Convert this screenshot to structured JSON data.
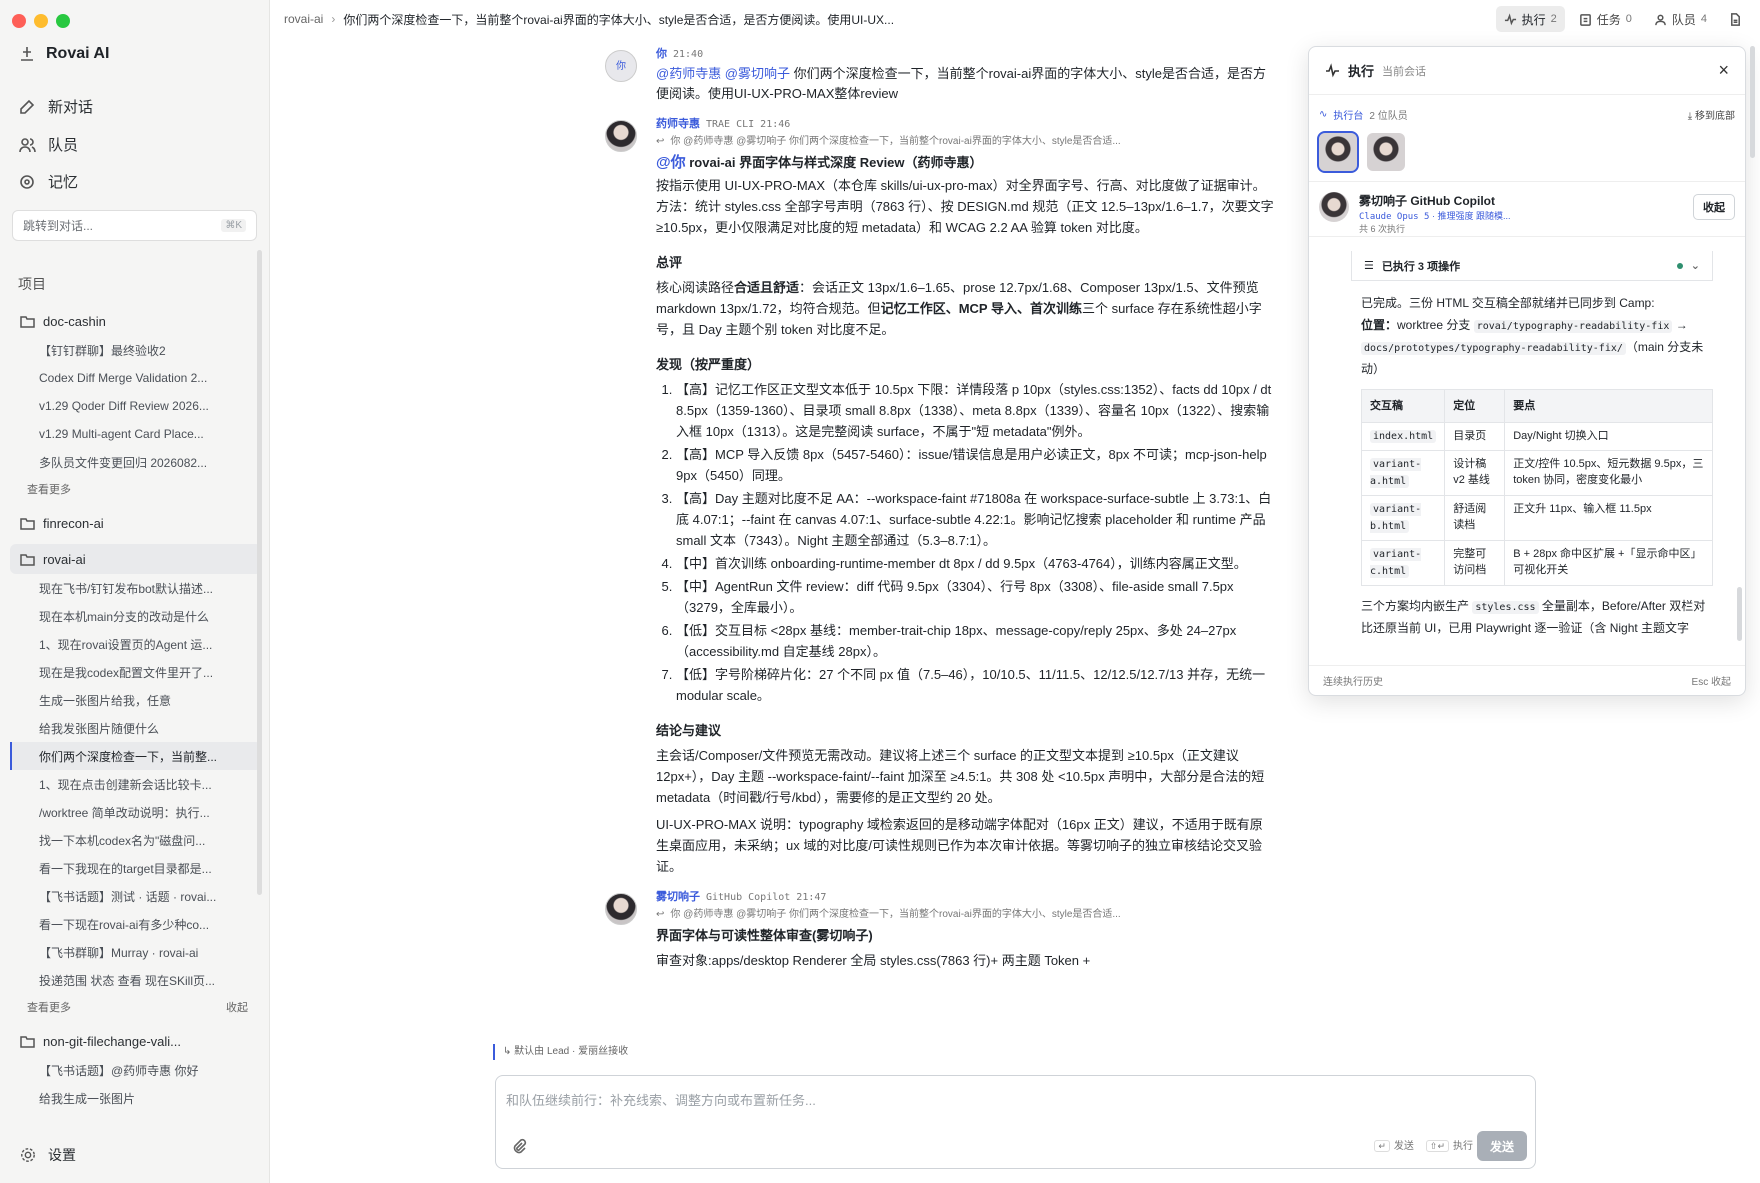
{
  "app": {
    "name": "Rovai AI",
    "traffic": [
      "#fe5f57",
      "#febc2e",
      "#28c840"
    ]
  },
  "nav": {
    "new_chat": "新对话",
    "team": "队员",
    "memory": "记忆"
  },
  "jump": {
    "placeholder": "跳转到对话...",
    "shortcut": "⌘K"
  },
  "projects_label": "项目",
  "projects": [
    {
      "name": "doc-cashin",
      "items": [
        "【钉钉群聊】最终验收2",
        "Codex Diff Merge Validation 2...",
        "v1.29 Qoder Diff Review 2026...",
        "v1.29 Multi-agent Card Place...",
        "多队员文件变更回归 2026082..."
      ],
      "more": "查看更多",
      "collapse": ""
    },
    {
      "name": "finrecon-ai",
      "items": [],
      "more": "",
      "collapse": ""
    },
    {
      "name": "rovai-ai",
      "items": [
        "现在飞书/钉钉发布bot默认描述...",
        "现在本机main分支的改动是什么",
        "1、现在rovai设置页的Agent 运...",
        "现在是我codex配置文件里开了...",
        "生成一张图片给我，任意",
        "给我发张图片随便什么",
        "你们两个深度检查一下，当前整...",
        "1、现在点击创建新会话比较卡...",
        "/worktree 简单改动说明：执行...",
        "找一下本机codex名为\"磁盘问...",
        "看一下我现在的target目录都是...",
        "【飞书话题】测试 · 话题 · rovai...",
        "看一下现在rovai-ai有多少种co...",
        "【飞书群聊】Murray · rovai-ai",
        "投递范围 状态 查看 现在SKill页..."
      ],
      "more": "查看更多",
      "collapse": "收起"
    },
    {
      "name": "non-git-filechange-vali...",
      "items": [
        "【飞书话题】@药师寺惠 你好",
        "给我生成一张图片"
      ],
      "more": "",
      "collapse": ""
    }
  ],
  "settings": "设置",
  "topbar": {
    "crumb": "rovai-ai",
    "sep": "›",
    "title": "你们两个深度检查一下，当前整个rovai-ai界面的字体大小、style是否合适，是否方便阅读。使用UI-UX...",
    "exec": {
      "label": "执行",
      "count": "2"
    },
    "tasks": {
      "label": "任务",
      "count": "0"
    },
    "members": {
      "label": "队员",
      "count": "4"
    }
  },
  "messages": {
    "user": {
      "avatar": "你",
      "name": "你",
      "time": "21:40",
      "mentions": "@药师寺惠 @雾切响子",
      "text": " 你们两个深度检查一下，当前整个rovai-ai界面的字体大小、style是否合适，是否方便阅读。使用UI-UX-PRO-MAX整体review"
    },
    "yaoshi": {
      "name": "药师寺惠",
      "source": "TRAE CLI",
      "time": "21:46",
      "reply": "你 @药师寺惠 @雾切响子 你们两个深度检查一下，当前整个rovai-ai界面的字体大小、style是否合适...",
      "at": "@你",
      "title": " rovai-ai 界面字体与样式深度 Review（药师寺惠）",
      "intro": "按指示使用 UI-UX-PRO-MAX（本仓库 skills/ui-ux-pro-max）对全界面字号、行高、对比度做了证据审计。方法：统计 styles.css 全部字号声明（7863 行）、按 DESIGN.md 规范（正文 12.5–13px/1.6–1.7，次要文字 ≥10.5px，更小仅限满足对比度的短 metadata）和 WCAG 2.2 AA 验算 token 对比度。",
      "h_summary": "总评",
      "summary_a": "核心阅读路径",
      "summary_b": "合适且舒适",
      "summary_c": "：会话正文 13px/1.6–1.65、prose 12.7px/1.68、Composer 13px/1.5、文件预览 markdown 13px/1.72，均符合规范。但",
      "summary_d": "记忆工作区、MCP 导入、首次训练",
      "summary_e": "三个 surface 存在系统性超小字号，且 Day 主题个别 token 对比度不足。",
      "h_findings": "发现（按严重度）",
      "findings": [
        "【高】记忆工作区正文型文本低于 10.5px 下限：详情段落 p 10px（styles.css:1352）、facts dd 10px / dt 8.5px（1359-1360）、目录项 small 8.8px（1338）、meta 8.8px（1339）、容量名 10px（1322）、搜索输入框 10px（1313）。这是完整阅读 surface，不属于\"短 metadata\"例外。",
        "【高】MCP 导入反馈 8px（5457-5460）：issue/错误信息是用户必读正文，8px 不可读；mcp-json-help 9px（5450）同理。",
        "【高】Day 主题对比度不足 AA：--workspace-faint #71808a 在 workspace-surface-subtle 上 3.73:1、白底 4.07:1；--faint 在 canvas 4.07:1、surface-subtle 4.22:1。影响记忆搜索 placeholder 和 runtime 产品 small 文本（7343）。Night 主题全部通过（5.3–8.7:1）。",
        "【中】首次训练 onboarding-runtime-member dt 8px / dd 9.5px（4763-4764），训练内容属正文型。",
        "【中】AgentRun 文件 review：diff 代码 9.5px（3304）、行号 8px（3308）、file-aside small 7.5px（3279，全库最小）。",
        "【低】交互目标 <28px 基线：member-trait-chip 18px、message-copy/reply 25px、多处 24–27px（accessibility.md 自定基线 28px）。",
        "【低】字号阶梯碎片化：27 个不同 px 值（7.5–46），10/10.5、11/11.5、12/12.5/12.7/13 并存，无统一 modular scale。"
      ],
      "h_conclusion": "结论与建议",
      "conclusion": "主会话/Composer/文件预览无需改动。建议将上述三个 surface 的正文型文本提到 ≥10.5px（正文建议 12px+），Day 主题 --workspace-faint/--faint 加深至 ≥4.5:1。共 308 处 <10.5px 声明中，大部分是合法的短 metadata（时间戳/行号/kbd），需要修的是正文型约 20 处。",
      "note": "UI-UX-PRO-MAX 说明：typography 域检索返回的是移动端字体配对（16px 正文）建议，不适用于既有原生桌面应用，未采纳；ux 域的对比度/可读性规则已作为本次审计依据。等雾切响子的独立审核结论交叉验证。"
    },
    "wuqie": {
      "name": "雾切响子",
      "source": "GitHub Copilot",
      "time": "21:47",
      "reply": "你 @药师寺惠 @雾切响子 你们两个深度检查一下，当前整个rovai-ai界面的字体大小、style是否合适...",
      "title": "界面字体与可读性整体审查(雾切响子)",
      "text": "审查对象:apps/desktop Renderer 全局 styles.css(7863 行)+ 两主题 Token +"
    }
  },
  "handoff": "默认由 Lead · 爱丽丝接收",
  "composer": {
    "placeholder": "和队伍继续前行：补充线索、调整方向或布置新任务...",
    "send_hint": "发送",
    "exec_hint": "执行",
    "send_key": "↵",
    "exec_key": "⇧↵",
    "send": "发送"
  },
  "panel": {
    "title": "执行",
    "subtitle": "当前会话",
    "close": "×",
    "bench": "执行台",
    "member_count": "2 位队员",
    "to_bottom": "移到底部",
    "agent": {
      "name": "雾切响子 GitHub Copilot",
      "model": "Claude Opus 5",
      "effort": "推理强度",
      "mode": "跟随模...",
      "runs": "共 6 次执行",
      "fold": "收起"
    },
    "steps": "已执行 3 项操作",
    "done": "已完成。三份 HTML 交互稿全部就绪并已同步到 Camp:",
    "loc_label": "位置：",
    "loc_a": "worktree 分支 ",
    "loc_branch": "rovai/typography-readability-fix",
    "loc_arrow": " → ",
    "loc_path": "docs/prototypes/typography-readability-fix/",
    "loc_b": "（main 分支未动）",
    "table": {
      "headers": [
        "交互稿",
        "定位",
        "要点"
      ],
      "rows": [
        [
          "index.html",
          "目录页",
          "Day/Night 切换入口"
        ],
        [
          "variant-a.html",
          "设计稿 v2 基线",
          "正文/控件 10.5px、短元数据 9.5px，三 token 协同，密度变化最小"
        ],
        [
          "variant-b.html",
          "舒适阅读档",
          "正文升 11px、输入框 11.5px"
        ],
        [
          "variant-c.html",
          "完整可访问档",
          "B + 28px 命中区扩展 +「显示命中区」可视化开关"
        ]
      ]
    },
    "tail_a": "三个方案均内嵌生产 ",
    "tail_code": "styles.css",
    "tail_b": " 全量副本，Before/After 双栏对比还原当前 UI，已用 Playwright 逐一验证（含 Night 主题文字",
    "footer_left": "连续执行历史",
    "footer_right": "Esc 收起"
  }
}
